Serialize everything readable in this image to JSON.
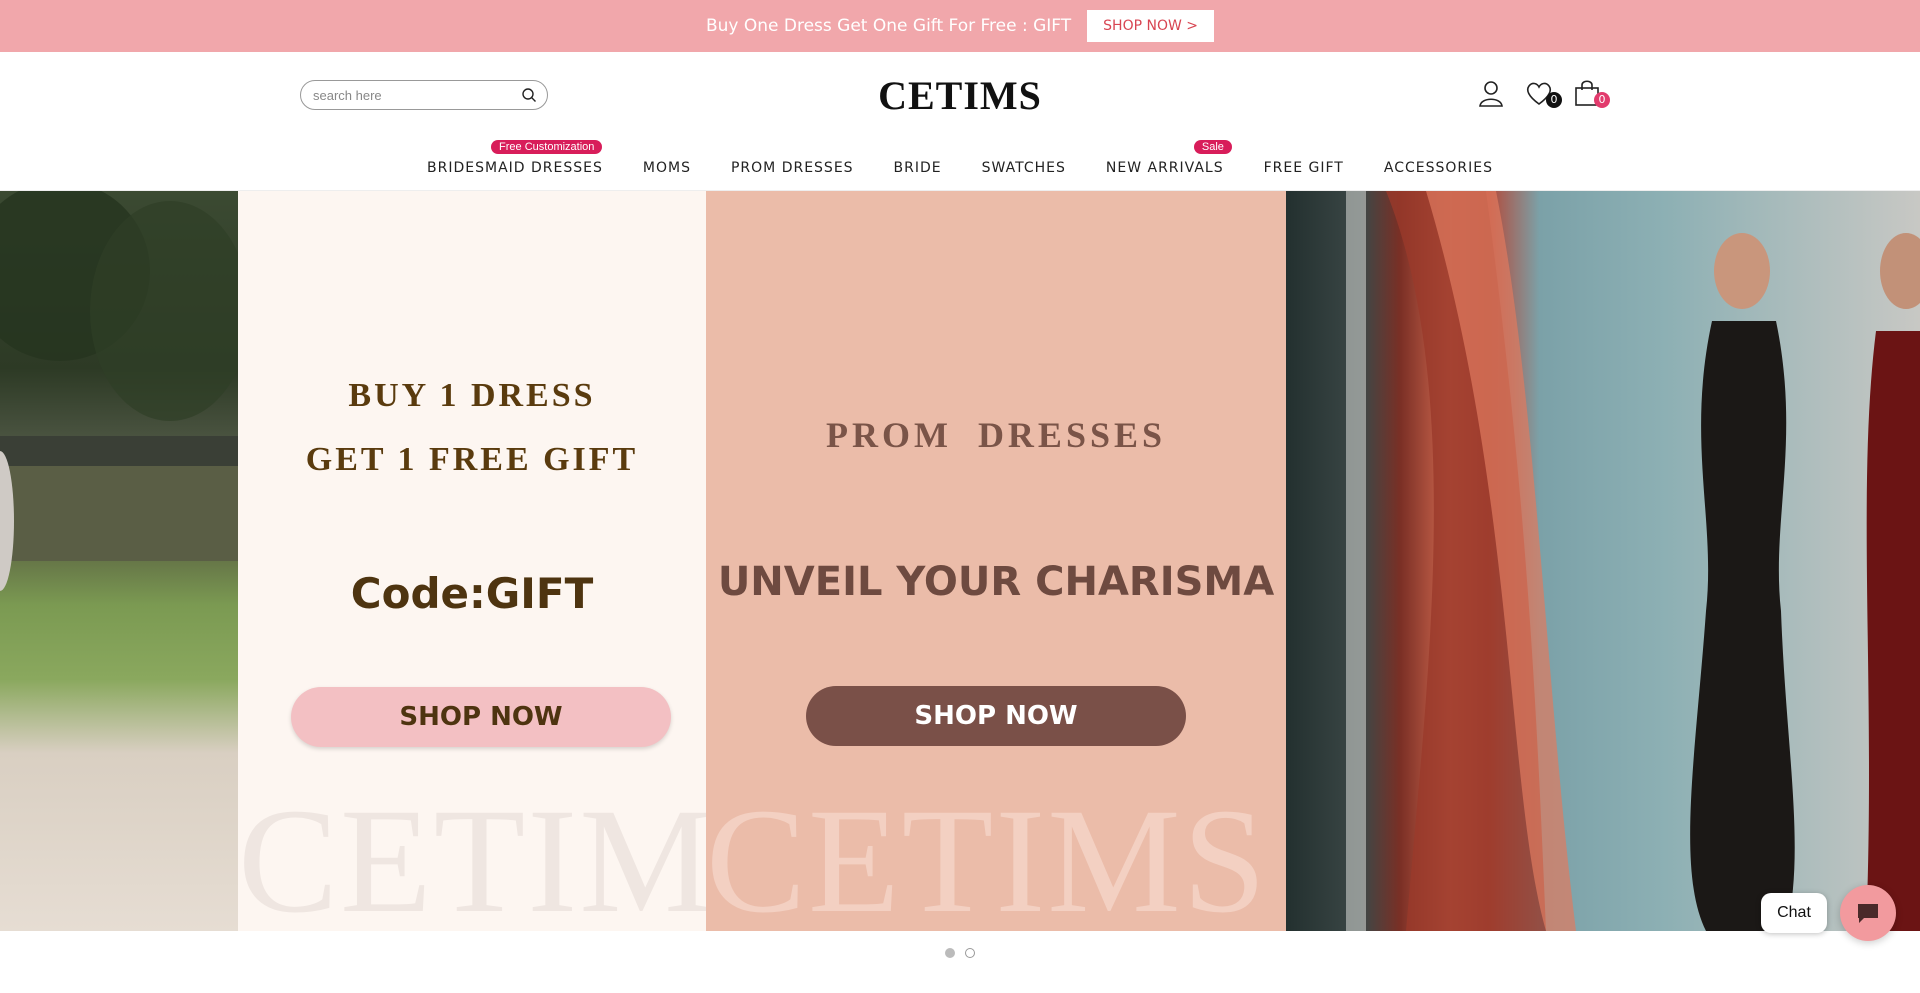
{
  "promo": {
    "text": "Buy One Dress Get One Gift For Free : GIFT",
    "button": "SHOP NOW >"
  },
  "header": {
    "search_placeholder": "search here",
    "logo": "CETIMS",
    "wishlist_count": "0",
    "cart_count": "0"
  },
  "nav": {
    "items": [
      {
        "label": "BRIDESMAID DRESSES",
        "tag": "Free Customization"
      },
      {
        "label": "MOMS"
      },
      {
        "label": "PROM DRESSES"
      },
      {
        "label": "BRIDE"
      },
      {
        "label": "SWATCHES"
      },
      {
        "label": "NEW ARRIVALS",
        "tag": "Sale"
      },
      {
        "label": "FREE GIFT"
      },
      {
        "label": "ACCESSORIES"
      }
    ]
  },
  "hero": {
    "panel1": {
      "line1": "BUY 1 DRESS",
      "line2": "GET 1 FREE GIFT",
      "code": "Code:GIFT",
      "button": "SHOP NOW",
      "watermark": "CETIMS"
    },
    "panel2": {
      "title": "PROM  DRESSES",
      "tagline": "UNVEIL YOUR CHARISMA",
      "button": "SHOP NOW",
      "watermark": "CETIMS"
    }
  },
  "slider": {
    "total": 2,
    "active": 1
  },
  "chat": {
    "label": "Chat"
  },
  "colors": {
    "promo_bg": "#f1a7ab",
    "accent_pink": "#d81d5a",
    "panel2_bg": "#ebbca9",
    "brown_text": "#5c3a12",
    "button_brown": "#7a5048"
  }
}
